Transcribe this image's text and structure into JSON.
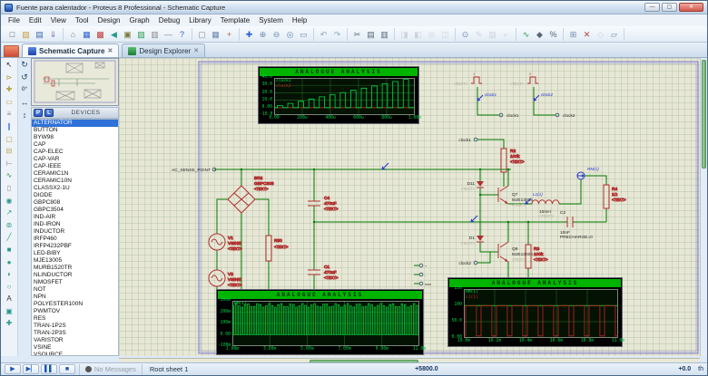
{
  "window": {
    "title": "Fuente para calentador - Proteus 8 Professional - Schematic Capture",
    "controls": [
      {
        "n": "minimize",
        "g": "—"
      },
      {
        "n": "maximize",
        "g": "▢"
      },
      {
        "n": "close",
        "g": "✕"
      }
    ]
  },
  "menu_bar": {
    "items": [
      "File",
      "Edit",
      "View",
      "Tool",
      "Design",
      "Graph",
      "Debug",
      "Library",
      "Template",
      "System",
      "Help"
    ]
  },
  "toolbar": {
    "groups": [
      [
        {
          "n": "new-design",
          "g": "□",
          "c": "#456"
        },
        {
          "n": "open-design",
          "g": "▨",
          "c": "#c99a3a"
        },
        {
          "n": "save-design",
          "g": "▤",
          "c": "#3a66b0"
        },
        {
          "n": "import-section",
          "g": "⇓",
          "c": "#7a5ab0"
        }
      ],
      [
        {
          "n": "home-page",
          "g": "⌂",
          "c": "#888888"
        },
        {
          "n": "schematic-capture",
          "g": "▦",
          "c": "#2b5fd0"
        },
        {
          "n": "pcb-layout",
          "g": "▩",
          "c": "#c03a3a"
        },
        {
          "n": "3d-viewer",
          "g": "◀",
          "c": "#2a9a8a"
        },
        {
          "n": "gerber-viewer",
          "g": "▣",
          "c": "#7a7a3a"
        },
        {
          "n": "design-explorer",
          "g": "▧",
          "c": "#2a9a4a"
        },
        {
          "n": "bill-of-materials",
          "g": "▥",
          "c": "#888888"
        },
        {
          "n": "simulation-advisor",
          "g": "—",
          "c": "#888888"
        },
        {
          "n": "help",
          "g": "?",
          "c": "#2b5fd0"
        }
      ],
      [
        {
          "n": "redraw",
          "g": "▢",
          "c": "#888888"
        },
        {
          "n": "grid-toggle",
          "g": "▦",
          "c": "#6a8ab0"
        },
        {
          "n": "origin",
          "g": "+",
          "c": "#b06a3a"
        }
      ],
      [
        {
          "n": "pan",
          "g": "✚",
          "c": "#2b5fd0"
        },
        {
          "n": "zoom-in",
          "g": "⊕",
          "c": "#6a8ab0"
        },
        {
          "n": "zoom-out",
          "g": "⊖",
          "c": "#6a8ab0"
        },
        {
          "n": "zoom-all",
          "g": "◎",
          "c": "#6a8ab0"
        },
        {
          "n": "zoom-area",
          "g": "▭",
          "c": "#6a8ab0"
        }
      ],
      [
        {
          "n": "undo",
          "g": "↶",
          "c": "#88aabb"
        },
        {
          "n": "redo",
          "g": "↷",
          "c": "#88aabb"
        }
      ],
      [
        {
          "n": "cut",
          "g": "✂",
          "c": "#556677"
        },
        {
          "n": "copy",
          "g": "▤",
          "c": "#556677"
        },
        {
          "n": "paste",
          "g": "▥",
          "c": "#556677"
        }
      ],
      [
        {
          "n": "block-copy",
          "g": "◨",
          "c": "#99a",
          "d": 1
        },
        {
          "n": "block-move",
          "g": "◧",
          "c": "#99a",
          "d": 1
        },
        {
          "n": "block-rotate",
          "g": "◎",
          "c": "#99a",
          "d": 1
        },
        {
          "n": "block-delete",
          "g": "◫",
          "c": "#99a",
          "d": 1
        }
      ],
      [
        {
          "n": "pick-parts",
          "g": "⊙",
          "c": "#6a8ab0"
        },
        {
          "n": "make-device",
          "g": "✎",
          "c": "#99a",
          "d": 1
        },
        {
          "n": "packaging-tool",
          "g": "▧",
          "c": "#99a",
          "d": 1
        },
        {
          "n": "decompose",
          "g": "⌐",
          "c": "#99a",
          "d": 1
        }
      ],
      [
        {
          "n": "wire-autorouter",
          "g": "∿",
          "c": "#2a9a4a"
        },
        {
          "n": "search-tag",
          "g": "◆",
          "c": "#556677"
        },
        {
          "n": "property-assignment",
          "g": "%",
          "c": "#556677"
        }
      ],
      [
        {
          "n": "new-sheet",
          "g": "⊞",
          "c": "#6a8ab0"
        },
        {
          "n": "remove-sheet",
          "g": "✕",
          "c": "#c03a3a"
        },
        {
          "n": "goto-sheet",
          "g": "◇",
          "c": "#99a",
          "d": 1
        },
        {
          "n": "zoom-to-child",
          "g": "▱",
          "c": "#6a8ab0"
        }
      ]
    ]
  },
  "tab_bar": {
    "close_glyph": "✕",
    "tabs": [
      {
        "label": "Schematic Capture",
        "active": true
      },
      {
        "label": "Design Explorer",
        "active": false
      }
    ]
  },
  "side_toolbar": {
    "tools": [
      {
        "n": "selection-mode",
        "g": "↖",
        "c": "#222"
      },
      {
        "n": "component-mode",
        "g": "⊳",
        "c": "#b0a03a"
      },
      {
        "n": "junction-dot-mode",
        "g": "✚",
        "c": "#b0a03a"
      },
      {
        "n": "wire-label-mode",
        "g": "▭",
        "c": "#b0a03a"
      },
      {
        "n": "text-script-mode",
        "g": "≡",
        "c": "#888"
      },
      {
        "n": "buses-mode",
        "g": "∥",
        "c": "#2b5fd0"
      },
      {
        "n": "subcircuit-mode",
        "g": "▢",
        "c": "#b0a03a"
      },
      {
        "n": "terminals-mode",
        "g": "⊟",
        "c": "#b0a03a"
      },
      {
        "n": "device-pins-mode",
        "g": "⊢",
        "c": "#888"
      },
      {
        "n": "graph-mode",
        "g": "∿",
        "c": "#2a9a4a"
      },
      {
        "n": "tape-recorder-mode",
        "g": "▯",
        "c": "#888"
      },
      {
        "n": "generator-mode",
        "g": "◉",
        "c": "#2a9a8a"
      },
      {
        "n": "voltage-probe-mode",
        "g": "↗",
        "c": "#2a9a8a"
      },
      {
        "n": "current-probe-mode",
        "g": "⊚",
        "c": "#2a9a8a"
      },
      {
        "n": "2d-line-mode",
        "g": "╱",
        "c": "#2a9a8a"
      },
      {
        "n": "2d-box-mode",
        "g": "■",
        "c": "#2a9a8a"
      },
      {
        "n": "2d-circle-mode",
        "g": "●",
        "c": "#2a9a8a"
      },
      {
        "n": "2d-arc-mode",
        "g": "◗",
        "c": "#2a9a8a"
      },
      {
        "n": "2d-path-mode",
        "g": "○",
        "c": "#2a9a8a"
      },
      {
        "n": "2d-text-mode",
        "g": "A",
        "c": "#333"
      },
      {
        "n": "2d-symbol-mode",
        "g": "▣",
        "c": "#2a9a8a"
      },
      {
        "n": "2d-marker-mode",
        "g": "✚",
        "c": "#2a9a8a"
      }
    ]
  },
  "orientation": {
    "rotate_cw": "↻",
    "rotate_ccw": "↺",
    "angle": "0°",
    "mirror_h": "↔",
    "mirror_v": "↕"
  },
  "devices_panel": {
    "pick": "P",
    "library": "L",
    "title": "DEVICES",
    "selected_index": 0,
    "items": [
      "ALTERNATOR",
      "BUTTON",
      "BYW98",
      "CAP",
      "CAP-ELEC",
      "CAP-VAR",
      "CAP-IEEE",
      "CERAMIC1N",
      "CERAMIC10N",
      "CLASSX2-1U",
      "DIODE",
      "GBPC808",
      "GBPC3504",
      "IND-AIR",
      "IND-IRON",
      "INDUCTOR",
      "IRFP460",
      "IRFP4232PBF",
      "LED-BIBY",
      "MJE13005",
      "MURB1520TR",
      "NLINDUCTOR",
      "NMOSFET",
      "NOT",
      "NPN",
      "POLYESTER100N",
      "PWMTOV",
      "RES",
      "TRAN-1P2S",
      "TRAN-2P3S",
      "VARISTOR",
      "VSINE",
      "VSOURCE"
    ]
  },
  "schematic": {
    "placeholder": "<TEXT>",
    "net_label": "AC_SENSE_POINT",
    "br2": {
      "ref": "BR2",
      "value": "GBPC308"
    },
    "v1": {
      "ref": "V1",
      "value": "VSINE"
    },
    "v2": {
      "ref": "V2",
      "value": "VSINE"
    },
    "r50": {
      "ref": "R50"
    },
    "c4": {
      "ref": "C4",
      "value": "470uF"
    },
    "c1": {
      "ref": "C1",
      "value": "470uF"
    },
    "r2": {
      "ref": "R2",
      "value": "100k"
    },
    "q7": {
      "ref": "Q7",
      "value": "MJE13005"
    },
    "d11": {
      "ref": "D11"
    },
    "d1": {
      "ref": "D1"
    },
    "q8": {
      "ref": "Q8",
      "value": "MJE13005"
    },
    "r3": {
      "ref": "R3",
      "value": "100k"
    },
    "l1": {
      "value": "10mH",
      "probe": "L1(1)"
    },
    "c2": {
      "ref": "C2",
      "value": "10nF",
      "property": "PRECHARGE=0"
    },
    "r4": {
      "ref": "R4",
      "value": "1Ω"
    },
    "rm_probe": "RM(1)",
    "gen1": {
      "index": "1",
      "probe": "clock1",
      "terminal": "clock1"
    },
    "gen2": {
      "index": "2",
      "probe": "clock2",
      "terminal": "clock2"
    },
    "drive1": "clock1",
    "drive2": "clock2",
    "aux_terminals": [
      "+",
      "-",
      "max"
    ]
  },
  "graphs": [
    {
      "title": "ANALOGUE ANALYSIS",
      "type": "line-pulse-ramp",
      "legend": [
        {
          "label": "clock1",
          "color": "#00dd44"
        },
        {
          "label": "clock2",
          "color": "#cc2222"
        }
      ],
      "y_ticks": [
        "40.0",
        "30.0",
        "20.0",
        "10.0",
        "0.00",
        "-10.0"
      ],
      "x_ticks": [
        "0.00",
        "200u",
        "400u",
        "600u",
        "800u",
        "1.00m"
      ],
      "trace": {
        "kind": "ramp",
        "count": 13,
        "duty": 0.5,
        "h0": 0.07,
        "h1": 0.95,
        "color": "#00dd44",
        "baseline": 0.8
      },
      "flats": [
        {
          "level": 0.8,
          "color": "#cc2222"
        }
      ]
    },
    {
      "title": "ANALOGUE ANALYSIS",
      "type": "line-pwm",
      "legend": [
        {
          "label": "RM(1)",
          "color": "#00dd44"
        }
      ],
      "y_ticks": [
        "300m",
        "200m",
        "100m",
        "0.00",
        "-100m"
      ],
      "x_ticks": [
        "1.00m",
        "3.00m",
        "5.00m",
        "7.00m",
        "9.00m",
        "11.0m"
      ],
      "trace": {
        "kind": "pwm",
        "count": 62,
        "duty": 0.5,
        "h": 0.92,
        "color": "#00cc33",
        "baseline": 0.75
      },
      "flats": []
    },
    {
      "title": "ANALOGUE ANALYSIS",
      "type": "line-square",
      "legend": [
        {
          "label": "RM(1)",
          "color": "#00dd44"
        },
        {
          "label": "L1(1)",
          "color": "#cc2222"
        }
      ],
      "y_ticks": [
        "150",
        "100",
        "50.0",
        "0.00"
      ],
      "x_ticks": [
        "10.0m",
        "10.2m",
        "10.4m",
        "10.6m",
        "10.8m",
        "11.0m"
      ],
      "trace": {
        "kind": "square",
        "count": 10,
        "duty": 0.7,
        "high": 0.34,
        "low": 0.96,
        "color": "#cc2222"
      },
      "flats": [
        {
          "level": 0.34,
          "color": "#00cc33"
        }
      ]
    }
  ],
  "status_bar": {
    "controls": [
      {
        "n": "play",
        "g": "▶"
      },
      {
        "n": "step",
        "g": "▶▏"
      },
      {
        "n": "pause",
        "g": "▌▌"
      },
      {
        "n": "stop",
        "g": "■"
      }
    ],
    "no_messages": "No Messages",
    "sheet_label": "Root sheet 1",
    "coord_x": "+5800.0",
    "coord_y": "+0.0",
    "coord_units": "th"
  },
  "colors": {
    "accent": "#2b5fd0",
    "canvas": "#e7e7d5",
    "graph_green": "#00cc33",
    "component_red": "#b03030",
    "wire_green": "#007a00",
    "probe_blue": "#2233cc",
    "selection_blue": "#2f71d9"
  }
}
